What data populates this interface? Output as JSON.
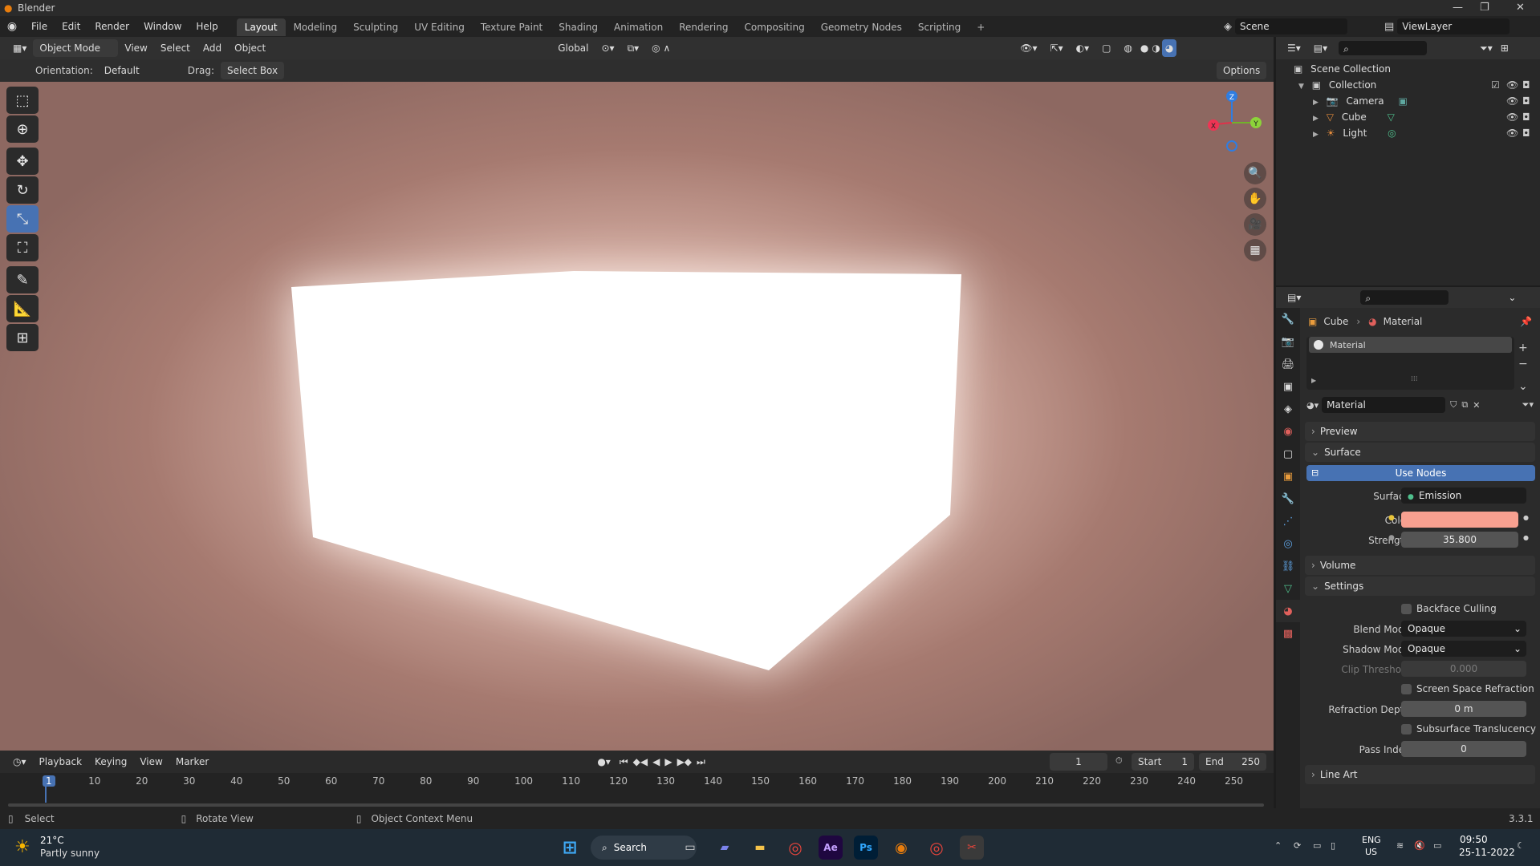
{
  "window": {
    "title": "Blender"
  },
  "menu": {
    "items": [
      "File",
      "Edit",
      "Render",
      "Window",
      "Help"
    ]
  },
  "workspaces": {
    "tabs": [
      "Layout",
      "Modeling",
      "Sculpting",
      "UV Editing",
      "Texture Paint",
      "Shading",
      "Animation",
      "Rendering",
      "Compositing",
      "Geometry Nodes",
      "Scripting"
    ],
    "active": "Layout",
    "add": "+"
  },
  "scene": {
    "name": "Scene",
    "view_layer": "ViewLayer"
  },
  "viewport_header": {
    "mode": "Object Mode",
    "menus": [
      "View",
      "Select",
      "Add",
      "Object"
    ],
    "transform": "Global"
  },
  "tool_settings": {
    "orientation_label": "Orientation:",
    "orientation_value": "Default",
    "drag_label": "Drag:",
    "drag_value": "Select Box",
    "options": "Options"
  },
  "gizmo": {
    "z": "Z",
    "y": "Y",
    "x": "X"
  },
  "outliner": {
    "root": "Scene Collection",
    "collection": "Collection",
    "items": [
      {
        "name": "Camera",
        "icon": "camera-icon",
        "color": "#e08a3c"
      },
      {
        "name": "Cube",
        "icon": "mesh-icon",
        "color": "#e08a3c"
      },
      {
        "name": "Light",
        "icon": "light-icon",
        "color": "#e08a3c"
      }
    ]
  },
  "properties": {
    "breadcrumb": {
      "object": "Cube",
      "material": "Material"
    },
    "slot_name": "Material",
    "material_name": "Material",
    "panels": {
      "preview": "Preview",
      "surface": "Surface",
      "volume": "Volume",
      "settings": "Settings",
      "line_art": "Line Art"
    },
    "use_nodes": "Use Nodes",
    "surface": {
      "label": "Surface",
      "value": "Emission"
    },
    "color": {
      "label": "Color",
      "hex": "#f8a090"
    },
    "strength": {
      "label": "Strength",
      "value": "35.800"
    },
    "settings": {
      "backface_culling": "Backface Culling",
      "blend_mode_label": "Blend Mode",
      "blend_mode": "Opaque",
      "shadow_mode_label": "Shadow Mode",
      "shadow_mode": "Opaque",
      "clip_threshold_label": "Clip Threshold",
      "clip_threshold": "0.000",
      "ssr": "Screen Space Refraction",
      "refraction_depth_label": "Refraction Depth",
      "refraction_depth": "0 m",
      "subsurface": "Subsurface Translucency",
      "pass_index_label": "Pass Index",
      "pass_index": "0"
    }
  },
  "timeline": {
    "menus": [
      "Playback",
      "Keying",
      "View",
      "Marker"
    ],
    "current_frame": "1",
    "start_label": "Start",
    "start": "1",
    "end_label": "End",
    "end": "250",
    "ticks": [
      "1",
      "10",
      "20",
      "30",
      "40",
      "50",
      "60",
      "70",
      "80",
      "90",
      "100",
      "110",
      "120",
      "130",
      "140",
      "150",
      "160",
      "170",
      "180",
      "190",
      "200",
      "210",
      "220",
      "230",
      "240",
      "250"
    ]
  },
  "statusbar": {
    "select": "Select",
    "rotate": "Rotate View",
    "context": "Object Context Menu",
    "version": "3.3.1"
  },
  "taskbar": {
    "weather_temp": "21°C",
    "weather_desc": "Partly sunny",
    "search": "Search",
    "lang": "ENG",
    "region": "US",
    "time": "09:50",
    "date": "25-11-2022"
  }
}
